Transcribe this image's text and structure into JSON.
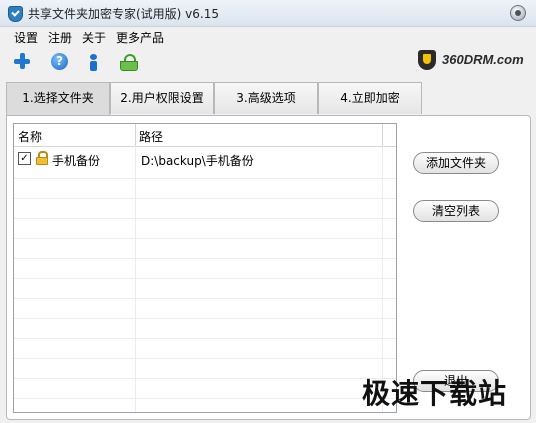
{
  "window": {
    "title": "共享文件夹加密专家(试用版) v6.15"
  },
  "menu": {
    "items": [
      "设置",
      "注册",
      "关于",
      "更多产品"
    ]
  },
  "toolbar": {
    "icons": [
      "add-icon",
      "help-icon",
      "info-icon",
      "purchase-icon"
    ],
    "help_glyph": "?"
  },
  "brand": {
    "logo_text": "360DRM.com",
    "accent": "#f2c300"
  },
  "tabs": [
    {
      "label": "1.选择文件夹",
      "active": true
    },
    {
      "label": "2.用户权限设置",
      "active": false
    },
    {
      "label": "3.高级选项",
      "active": false
    },
    {
      "label": "4.立即加密",
      "active": false
    }
  ],
  "list": {
    "columns": [
      "名称",
      "路径"
    ],
    "rows": [
      {
        "checked": true,
        "check_glyph": "✓",
        "name": "手机备份",
        "path": "D:\\backup\\手机备份"
      }
    ]
  },
  "buttons": {
    "add_folder": "添加文件夹",
    "clear_list": "清空列表",
    "exit": "退出"
  },
  "watermark": "极速下载站"
}
